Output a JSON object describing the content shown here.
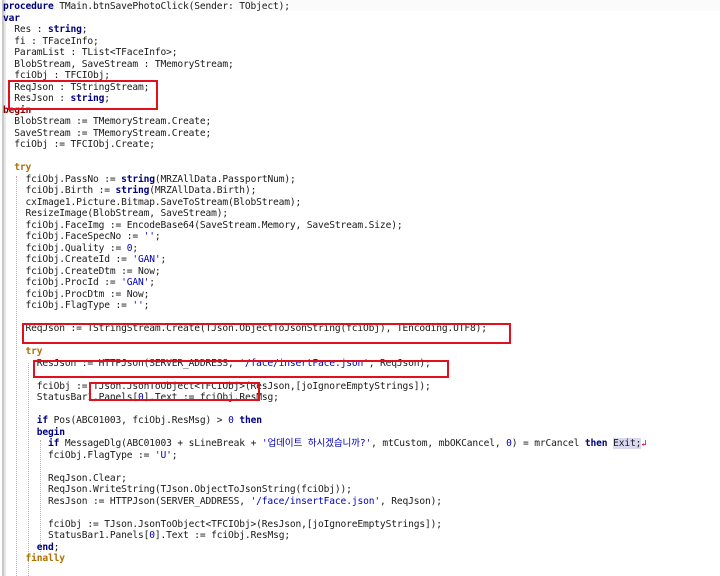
{
  "editor": {
    "lines": [
      {
        "segments": [
          {
            "t": "procedure",
            "c": "kw"
          },
          {
            "t": " TMain.btnSavePhotoClick(Sender: TObject);"
          }
        ]
      },
      {
        "segments": [
          {
            "t": "var",
            "c": "kw"
          }
        ]
      },
      {
        "segments": [
          {
            "t": "  Res : "
          },
          {
            "t": "string",
            "c": "kw"
          },
          {
            "t": ";"
          }
        ]
      },
      {
        "segments": [
          {
            "t": "  fi : TFaceInfo;"
          }
        ]
      },
      {
        "segments": [
          {
            "t": "  ParamList : TList<TFaceInfo>;"
          }
        ]
      },
      {
        "segments": [
          {
            "t": "  BlobStream, SaveStream : TMemoryStream;"
          }
        ]
      },
      {
        "segments": [
          {
            "t": "  fciObj : TFCIObj;"
          }
        ]
      },
      {
        "segments": [
          {
            "t": "  ReqJson : TStringStream;"
          }
        ]
      },
      {
        "segments": [
          {
            "t": "  ResJson : "
          },
          {
            "t": "string",
            "c": "kw"
          },
          {
            "t": ";"
          }
        ]
      },
      {
        "segments": [
          {
            "t": "begin",
            "c": "kw-begin"
          }
        ]
      },
      {
        "segments": [
          {
            "t": "  BlobStream := TMemoryStream.Create;"
          }
        ]
      },
      {
        "segments": [
          {
            "t": "  SaveStream := TMemoryStream.Create;"
          }
        ]
      },
      {
        "segments": [
          {
            "t": "  fciObj := TFCIObj.Create;"
          }
        ]
      },
      {
        "segments": [
          {
            "t": ""
          }
        ]
      },
      {
        "segments": [
          {
            "t": "  "
          },
          {
            "t": "try",
            "c": "kw-try"
          }
        ]
      },
      {
        "segments": [
          {
            "t": "    fciObj.PassNo := "
          },
          {
            "t": "string",
            "c": "kw"
          },
          {
            "t": "(MRZAllData.PassportNum);"
          }
        ]
      },
      {
        "segments": [
          {
            "t": "    fciObj.Birth := "
          },
          {
            "t": "string",
            "c": "kw"
          },
          {
            "t": "(MRZAllData.Birth);"
          }
        ]
      },
      {
        "segments": [
          {
            "t": "    cxImage1.Picture.Bitmap.SaveToStream(BlobStream);"
          }
        ]
      },
      {
        "segments": [
          {
            "t": "    ResizeImage(BlobStream, SaveStream);"
          }
        ]
      },
      {
        "segments": [
          {
            "t": "    fciObj.FaceImg := EncodeBase64(SaveStream.Memory, SaveStream.Size);"
          }
        ]
      },
      {
        "segments": [
          {
            "t": "    fciObj.FaceSpecNo := "
          },
          {
            "t": "''",
            "c": "str"
          },
          {
            "t": ";"
          }
        ]
      },
      {
        "segments": [
          {
            "t": "    fciObj.Quality := "
          },
          {
            "t": "0",
            "c": "num"
          },
          {
            "t": ";"
          }
        ]
      },
      {
        "segments": [
          {
            "t": "    fciObj.CreateId := "
          },
          {
            "t": "'GAN'",
            "c": "str"
          },
          {
            "t": ";"
          }
        ]
      },
      {
        "segments": [
          {
            "t": "    fciObj.CreateDtm := Now;"
          }
        ]
      },
      {
        "segments": [
          {
            "t": "    fciObj.ProcId := "
          },
          {
            "t": "'GAN'",
            "c": "str"
          },
          {
            "t": ";"
          }
        ]
      },
      {
        "segments": [
          {
            "t": "    fciObj.ProcDtm := Now;"
          }
        ]
      },
      {
        "segments": [
          {
            "t": "    fciObj.FlagType := "
          },
          {
            "t": "''",
            "c": "str"
          },
          {
            "t": ";"
          }
        ]
      },
      {
        "segments": [
          {
            "t": ""
          }
        ]
      },
      {
        "segments": [
          {
            "t": "    ReqJson := TStringStream.Create(TJson.ObjectToJsonString(fciObj), TEncoding.UTF8);"
          }
        ]
      },
      {
        "segments": [
          {
            "t": ""
          }
        ]
      },
      {
        "segments": [
          {
            "t": "    "
          },
          {
            "t": "try",
            "c": "kw-try"
          }
        ]
      },
      {
        "segments": [
          {
            "t": "      ResJson := HTTPJson(SERVER_ADDRESS, "
          },
          {
            "t": "'/face/insertFace.json'",
            "c": "str"
          },
          {
            "t": ", ReqJson);"
          }
        ]
      },
      {
        "segments": [
          {
            "t": ""
          }
        ]
      },
      {
        "segments": [
          {
            "t": "      fciObj := TJson.JsonToObject<TFCIObj>(ResJson,[joIgnoreEmptyStrings]);"
          }
        ]
      },
      {
        "segments": [
          {
            "t": "      StatusBar1.Panels["
          },
          {
            "t": "0",
            "c": "num"
          },
          {
            "t": "].Text := fciObj.ResMsg;"
          }
        ]
      },
      {
        "segments": [
          {
            "t": ""
          }
        ]
      },
      {
        "segments": [
          {
            "t": "      "
          },
          {
            "t": "if",
            "c": "kw"
          },
          {
            "t": " Pos(ABC01003, fciObj.ResMsg) > "
          },
          {
            "t": "0",
            "c": "num"
          },
          {
            "t": " "
          },
          {
            "t": "then",
            "c": "kw"
          }
        ]
      },
      {
        "segments": [
          {
            "t": "      "
          },
          {
            "t": "begin",
            "c": "kw"
          }
        ]
      },
      {
        "segments": [
          {
            "t": "        "
          },
          {
            "t": "if",
            "c": "kw"
          },
          {
            "t": " MessageDlg(ABC01003 + sLineBreak + "
          },
          {
            "t": "'업데이트 하시겠습니까?'",
            "c": "str"
          },
          {
            "t": ", mtCustom, mbOKCancel, "
          },
          {
            "t": "0",
            "c": "num"
          },
          {
            "t": ") = mrCancel "
          },
          {
            "t": "then",
            "c": "kw"
          },
          {
            "t": " "
          },
          {
            "t": "Exit;",
            "c": "sel"
          },
          {
            "t": "↲",
            "c": "caret-mark"
          }
        ]
      },
      {
        "segments": [
          {
            "t": "        fciObj.FlagType := "
          },
          {
            "t": "'U'",
            "c": "str"
          },
          {
            "t": ";"
          }
        ]
      },
      {
        "segments": [
          {
            "t": ""
          }
        ]
      },
      {
        "segments": [
          {
            "t": "        ReqJson.Clear;"
          }
        ]
      },
      {
        "segments": [
          {
            "t": "        ReqJson.WriteString(TJson.ObjectToJsonString(fciObj));"
          }
        ]
      },
      {
        "segments": [
          {
            "t": "        ResJson := HTTPJson(SERVER_ADDRESS, "
          },
          {
            "t": "'/face/insertFace.json'",
            "c": "str"
          },
          {
            "t": ", ReqJson);"
          }
        ]
      },
      {
        "segments": [
          {
            "t": ""
          }
        ]
      },
      {
        "segments": [
          {
            "t": "        fciObj := TJson.JsonToObject<TFCIObj>(ResJson,[joIgnoreEmptyStrings]);"
          }
        ]
      },
      {
        "segments": [
          {
            "t": "        StatusBar1.Panels["
          },
          {
            "t": "0",
            "c": "num"
          },
          {
            "t": "].Text := fciObj.ResMsg;"
          }
        ]
      },
      {
        "segments": [
          {
            "t": "      "
          },
          {
            "t": "end",
            "c": "kw"
          },
          {
            "t": ";"
          }
        ]
      },
      {
        "segments": [
          {
            "t": "    "
          },
          {
            "t": "finally",
            "c": "kw-try"
          }
        ]
      },
      {
        "segments": [
          {
            "t": "    "
          }
        ]
      }
    ]
  },
  "colors": {
    "keyword": "#00007f",
    "string": "#0000c0",
    "try_keyword": "#b07000",
    "highlight_box": "#e0101f"
  }
}
